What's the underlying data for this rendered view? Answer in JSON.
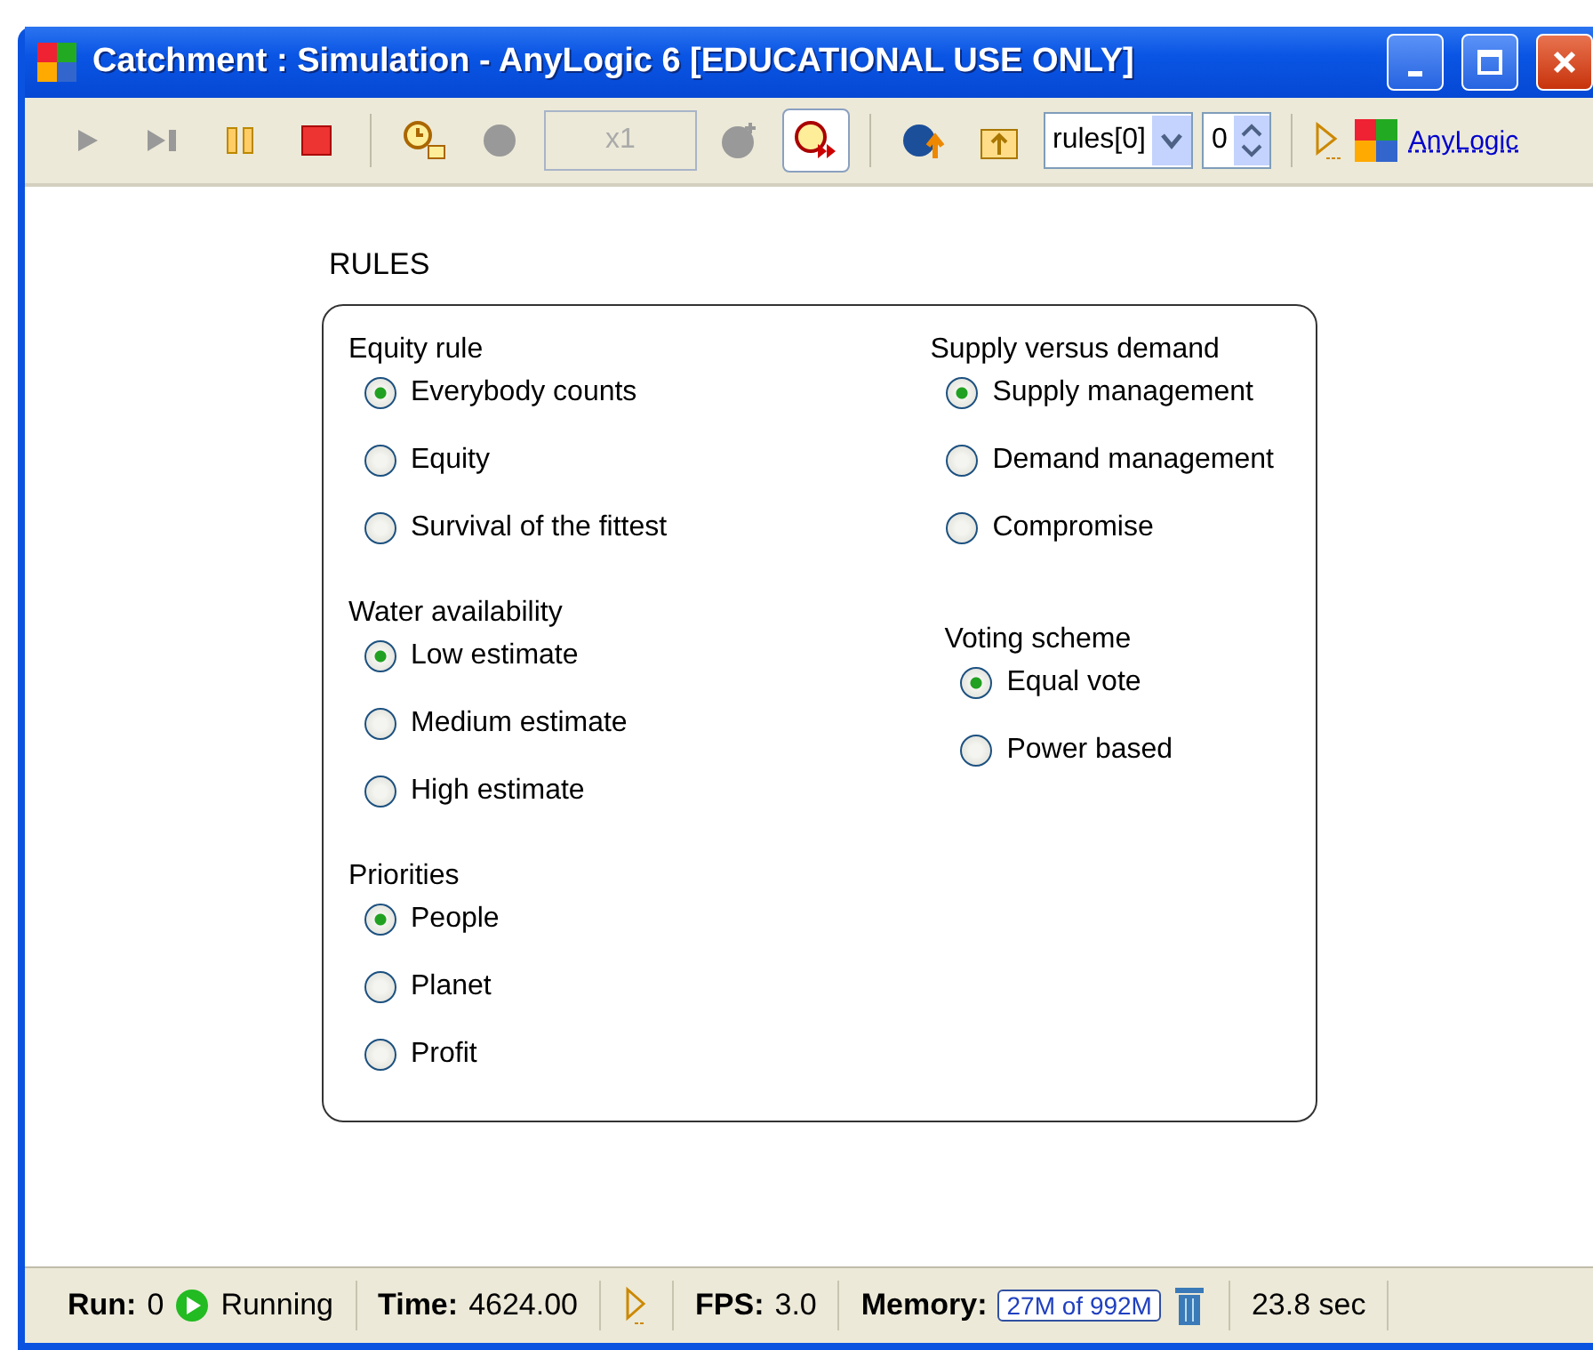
{
  "window": {
    "title": "Catchment : Simulation - AnyLogic 6 [EDUCATIONAL USE ONLY]"
  },
  "toolbar": {
    "speed": "x1",
    "realtime_on": true,
    "selector": "rules[0]",
    "index": "0",
    "link": "AnyLogic"
  },
  "panel": {
    "title": "RULES",
    "columns": [
      {
        "groups": [
          {
            "heading": "Equity rule",
            "options": [
              {
                "label": "Everybody counts",
                "selected": true
              },
              {
                "label": "Equity",
                "selected": false
              },
              {
                "label": "Survival of the fittest",
                "selected": false
              }
            ]
          },
          {
            "heading": "Water availability",
            "options": [
              {
                "label": "Low estimate",
                "selected": true
              },
              {
                "label": "Medium estimate",
                "selected": false
              },
              {
                "label": "High estimate",
                "selected": false
              }
            ]
          },
          {
            "heading": "Priorities",
            "options": [
              {
                "label": "People",
                "selected": true
              },
              {
                "label": "Planet",
                "selected": false
              },
              {
                "label": "Profit",
                "selected": false
              }
            ]
          }
        ]
      },
      {
        "groups": [
          {
            "heading": "Supply versus demand",
            "options": [
              {
                "label": "Supply management",
                "selected": true
              },
              {
                "label": "Demand management",
                "selected": false
              },
              {
                "label": "Compromise",
                "selected": false
              }
            ]
          },
          {
            "heading": "Voting scheme",
            "indented": true,
            "options": [
              {
                "label": "Equal vote",
                "selected": true
              },
              {
                "label": "Power based",
                "selected": false
              }
            ]
          }
        ]
      }
    ]
  },
  "status_bar": {
    "run_label": "Run:",
    "run": "0",
    "state": "Running",
    "time_label": "Time:",
    "time": "4624.00",
    "fps_label": "FPS:",
    "fps": "3.0",
    "memory_label": "Memory:",
    "memory": "27M of 992M",
    "elapsed": "23.8 sec"
  }
}
